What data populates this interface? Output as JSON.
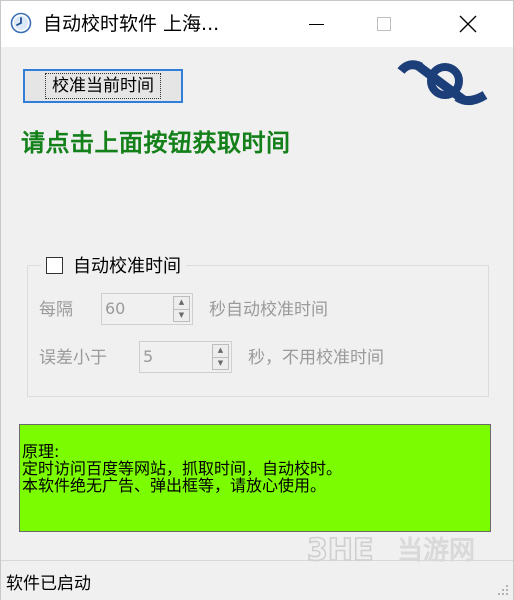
{
  "window": {
    "title": "自动校时软件 上海...",
    "icons": {
      "app": "clock-app-icon",
      "minimize": "minimize-icon",
      "maximize": "maximize-icon",
      "close": "close-icon"
    }
  },
  "main": {
    "sync_button_label": "校准当前时间",
    "prompt_text": "请点击上面按钮获取时间",
    "logo": "brand-logo",
    "colors": {
      "prompt": "#13801a",
      "info_bg": "#7cfc00",
      "button_focus": "#2f7fd8"
    }
  },
  "auto_group": {
    "checkbox_label": "自动校准时间",
    "checked": false,
    "interval_prefix": "每隔",
    "interval_value": "60",
    "interval_suffix": "秒自动校准时间",
    "tolerance_prefix": "误差小于",
    "tolerance_value": "5",
    "tolerance_suffix": "秒，不用校准时间"
  },
  "info": {
    "lines": [
      "原理:",
      "定时访问百度等网站，抓取时间，自动校时。",
      "本软件绝无广告、弹出框等，请放心使用。"
    ]
  },
  "status": {
    "text": "软件已启动"
  },
  "watermark": {
    "brand": "3HE",
    "text": "当游网"
  }
}
